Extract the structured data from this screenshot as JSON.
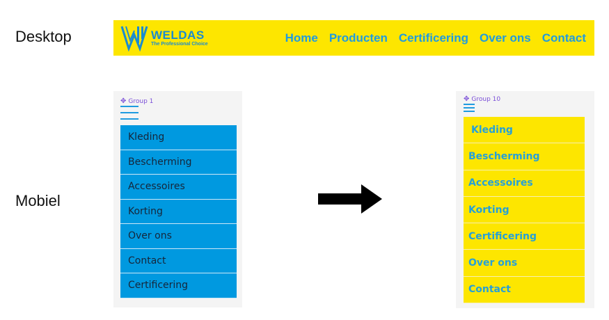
{
  "labels": {
    "desktop": "Desktop",
    "mobile": "Mobiel"
  },
  "desktop_nav": {
    "brand": "WELDAS",
    "tagline": "The Professional Choice",
    "links": [
      "Home",
      "Producten",
      "Certificering",
      "Over ons",
      "Contact"
    ],
    "background": "#fde600",
    "link_color": "#1f9be0"
  },
  "mobile_before": {
    "group_label": "Group 1",
    "menu_icon": "hamburger-icon",
    "items": [
      "Kleding",
      "Bescherming",
      "Accessoires",
      "Korting",
      "Over ons",
      "Contact",
      "Certificering"
    ],
    "item_background": "#0099e0",
    "item_text_color": "#16263a"
  },
  "mobile_after": {
    "group_label": "Group 10",
    "menu_icon": "hamburger-icon",
    "items": [
      "Kleding",
      "Bescherming",
      "Accessoires",
      "Korting",
      "Certificering",
      "Over ons",
      "Contact"
    ],
    "item_background": "#fde600",
    "item_text_color": "#26a0d8"
  },
  "transition_icon": "arrow-right-icon"
}
